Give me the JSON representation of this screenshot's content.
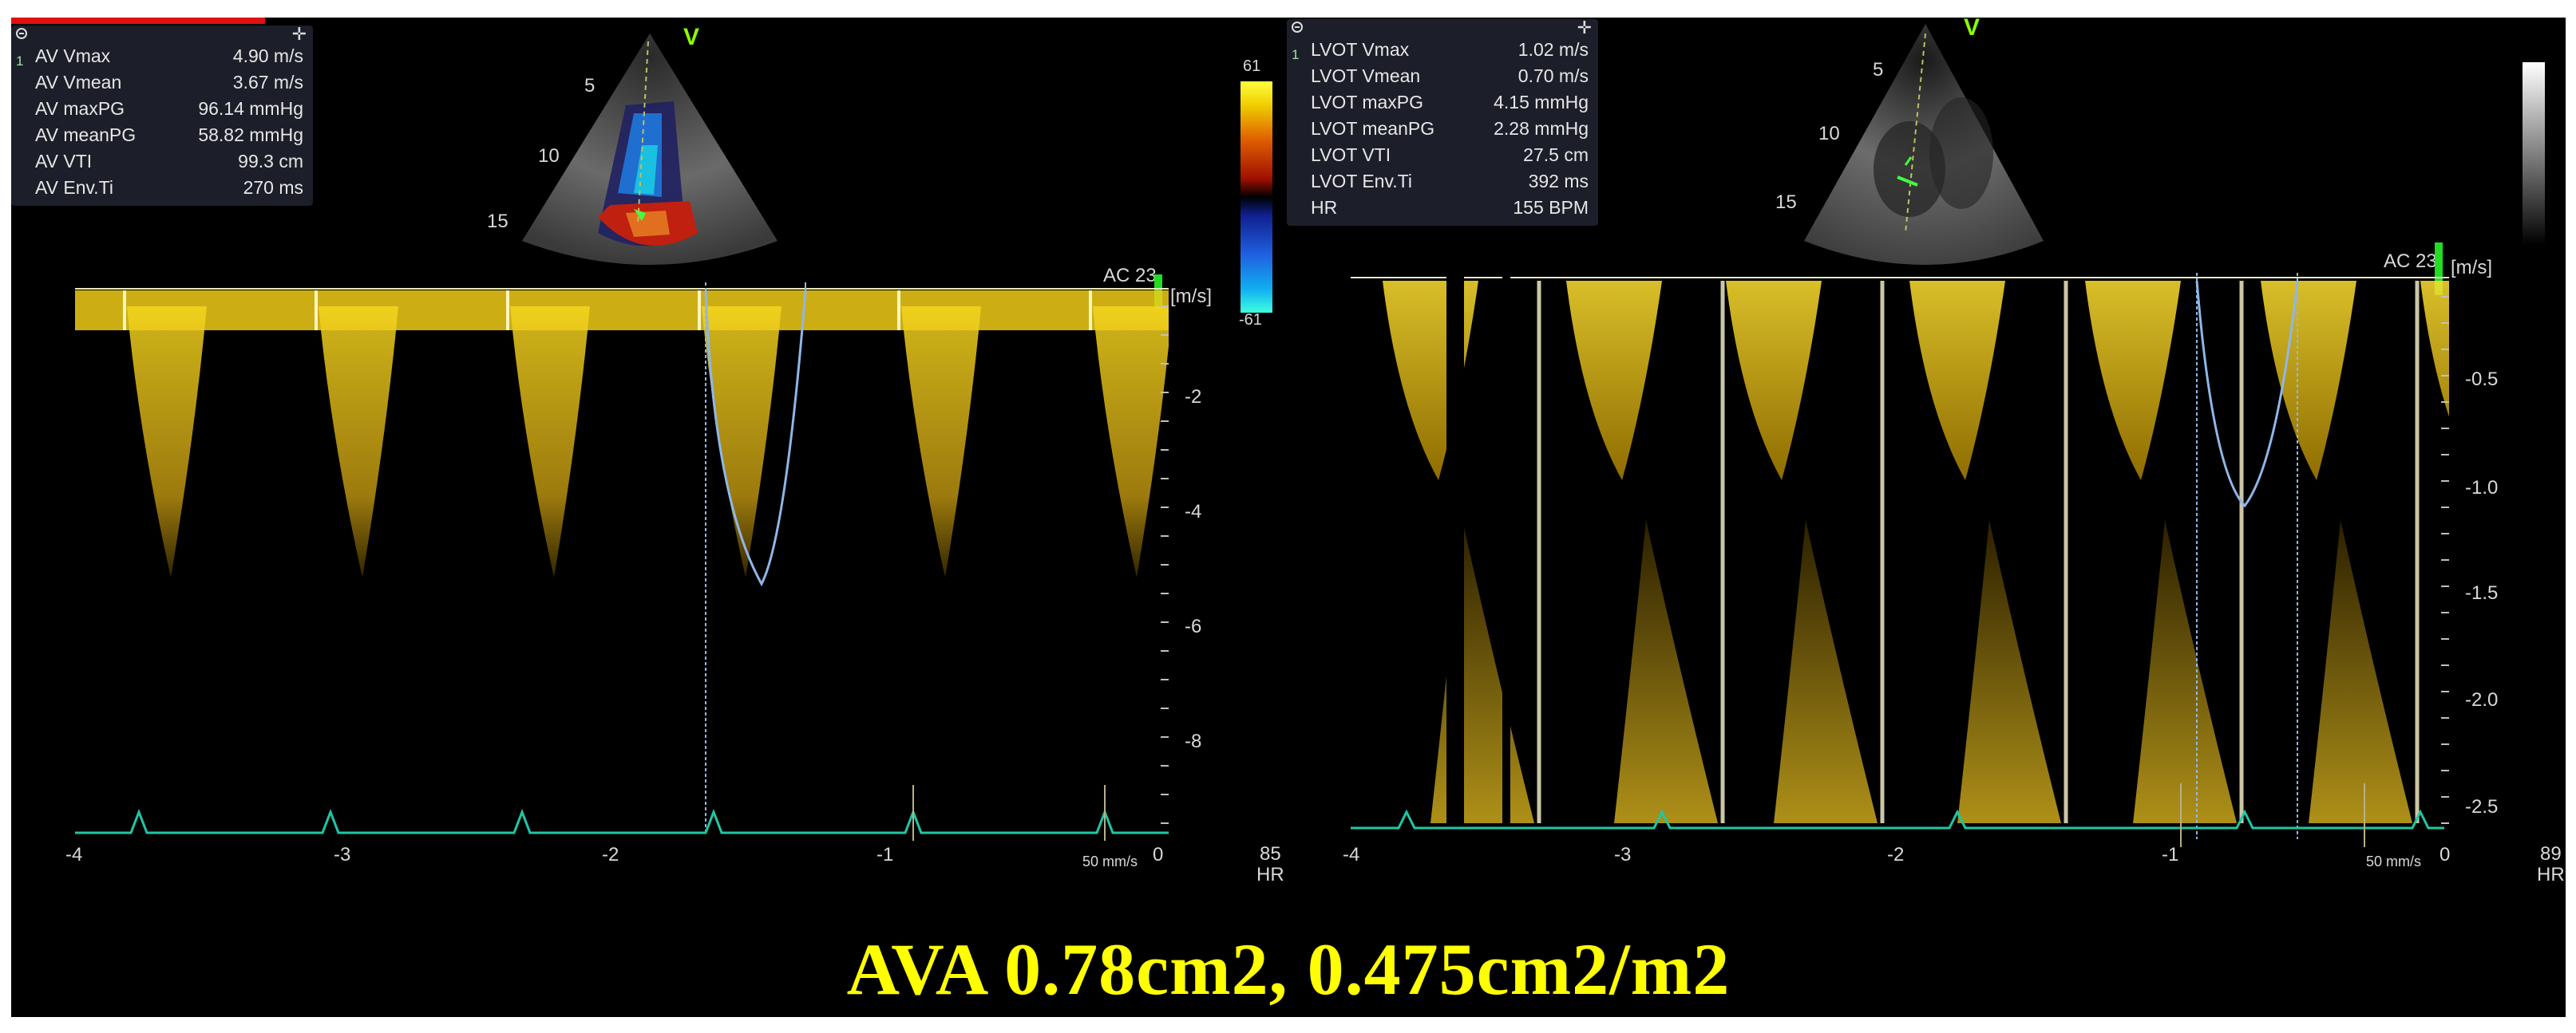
{
  "caption": "AVA 0.78cm2, 0.475cm2/m2",
  "left_panel": {
    "measurements": [
      {
        "label": "AV Vmax",
        "value": "4.90 m/s"
      },
      {
        "label": "AV Vmean",
        "value": "3.67 m/s"
      },
      {
        "label": "AV maxPG",
        "value": "96.14 mmHg"
      },
      {
        "label": "AV meanPG",
        "value": "58.82 mmHg"
      },
      {
        "label": "AV VTI",
        "value": "99.3 cm"
      },
      {
        "label": "AV Env.Ti",
        "value": "270 ms"
      }
    ],
    "measurement_index": "1",
    "v_mark": "V",
    "depth_ticks": [
      "5",
      "10",
      "15"
    ],
    "color_scale": {
      "top": "61",
      "bottom": "-61"
    },
    "ac_label": "AC 23",
    "unit": "[m/s]",
    "y_ticks": [
      "-2",
      "-4",
      "-6",
      "-8"
    ],
    "x_ticks": [
      "-4",
      "-3",
      "-2",
      "-1",
      "0"
    ],
    "sweep_speed": "50 mm/s",
    "hr_value": "85",
    "hr_label": "HR"
  },
  "right_panel": {
    "measurements": [
      {
        "label": "LVOT Vmax",
        "value": "1.02 m/s"
      },
      {
        "label": "LVOT Vmean",
        "value": "0.70 m/s"
      },
      {
        "label": "LVOT maxPG",
        "value": "4.15 mmHg"
      },
      {
        "label": "LVOT meanPG",
        "value": "2.28 mmHg"
      },
      {
        "label": "LVOT VTI",
        "value": "27.5 cm"
      },
      {
        "label": "LVOT Env.Ti",
        "value": "392 ms"
      },
      {
        "label": "HR",
        "value": "155 BPM"
      }
    ],
    "measurement_index": "1",
    "v_mark": "V",
    "depth_ticks": [
      "5",
      "10",
      "15"
    ],
    "ac_label": "AC 23",
    "unit": "[m/s]",
    "y_ticks": [
      "-0.5",
      "-1.0",
      "-1.5",
      "-2.0",
      "-2.5"
    ],
    "x_ticks": [
      "-4",
      "-3",
      "-2",
      "-1",
      "0"
    ],
    "sweep_speed": "50 mm/s",
    "hr_value": "89",
    "hr_label": "HR"
  },
  "colors": {
    "doppler": "#f2d21a",
    "trace": "#8fb6e8",
    "ecg": "#1ec7a5",
    "caption": "#ffff00",
    "label_green": "#8cff00"
  }
}
